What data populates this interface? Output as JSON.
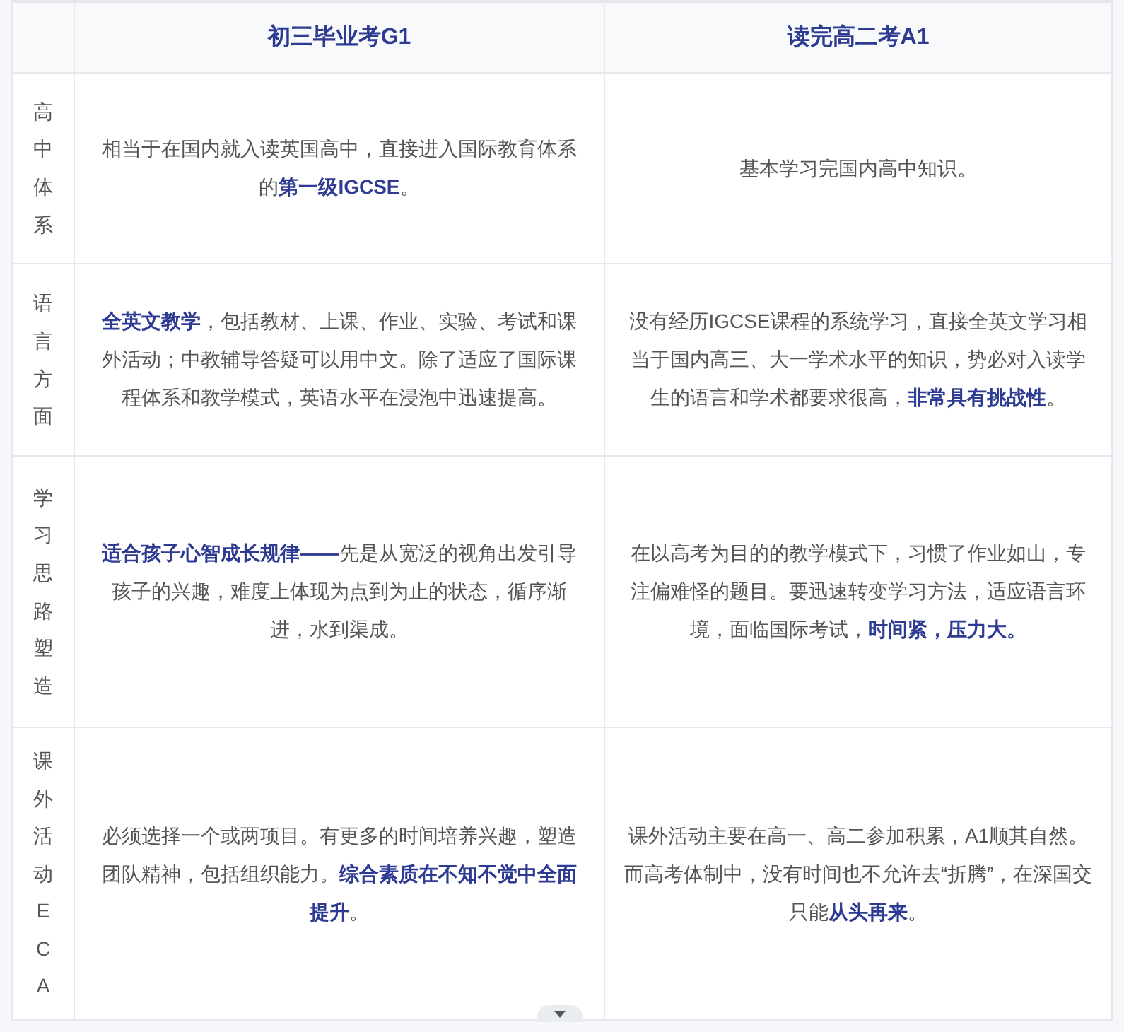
{
  "table": {
    "columns": [
      "初三毕业考G1",
      "读完高二考A1"
    ],
    "rows": [
      {
        "label": "高中体系",
        "cells": [
          "相当于在国内就入读英国高中，直接进入国际教育体系的**第一级IGCSE**。",
          "基本学习完国内高中知识。"
        ]
      },
      {
        "label": "语言方面",
        "cells": [
          "**全英文教学**，包括教材、上课、作业、实验、考试和课外活动；中教辅导答疑可以用中文。除了适应了国际课程体系和教学模式，英语水平在浸泡中迅速提高。",
          "没有经历IGCSE课程的系统学习，直接全英文学习相当于国内高三、大一学术水平的知识，势必对入读学生的语言和学术都要求很高，**非常具有挑战性**。"
        ]
      },
      {
        "label": "学习思路塑造",
        "cells": [
          "**适合孩子心智成长规律——**先是从宽泛的视角出发引导孩子的兴趣，难度上体现为点到为止的状态，循序渐进，水到渠成。",
          "在以高考为目的的教学模式下，习惯了作业如山，专注偏难怪的题目。要迅速转变学习方法，适应语言环境，面临国际考试，**时间紧，压力大。**"
        ]
      },
      {
        "label": "课外活动ECA",
        "cells": [
          "必须选择一个或两项目。有更多的时间培养兴趣，塑造团队精神，包括组织能力。**综合素质在不知不觉中全面提升**。",
          "课外活动主要在高一、高二参加积累，A1顺其自然。而高考体制中，没有时间也不允许去“折腾”，在深国交只能**从头再来**。"
        ]
      }
    ]
  }
}
